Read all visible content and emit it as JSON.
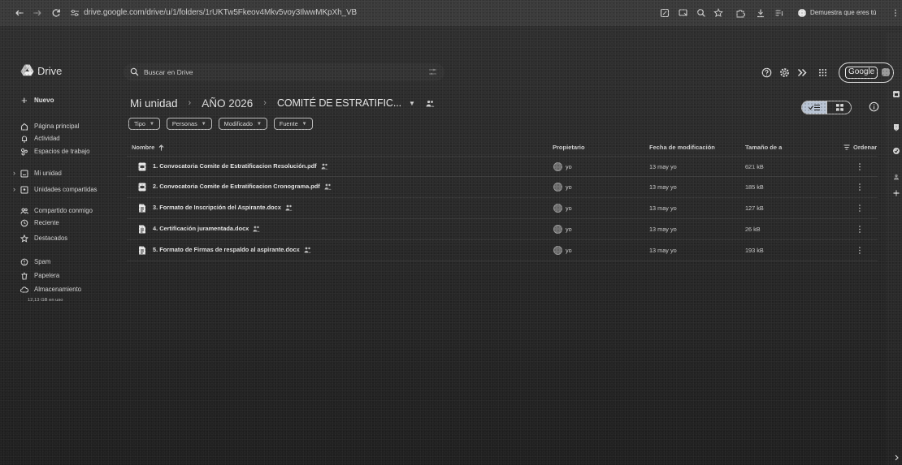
{
  "browser": {
    "url": "drive.google.com/drive/u/1/folders/1rUKTw5Fkeov4Mkv5voy3IlwwMKpXh_VB",
    "profile_label": "Demuestra que eres tú"
  },
  "header": {
    "app_name": "Drive",
    "search_placeholder": "Buscar en Drive",
    "account_label": "Google"
  },
  "sidebar": {
    "new_label": "Nuevo",
    "items": [
      {
        "label": "Página principal",
        "icon": "home-icon"
      },
      {
        "label": "Actividad",
        "icon": "bell-icon"
      },
      {
        "label": "Espacios de trabajo",
        "icon": "workspaces-icon"
      },
      {
        "label": "Mi unidad",
        "icon": "my-drive-icon"
      },
      {
        "label": "Unidades compartidas",
        "icon": "shared-drives-icon"
      },
      {
        "label": "Compartido conmigo",
        "icon": "shared-with-me-icon"
      },
      {
        "label": "Reciente",
        "icon": "clock-icon"
      },
      {
        "label": "Destacados",
        "icon": "star-icon"
      },
      {
        "label": "Spam",
        "icon": "spam-icon"
      },
      {
        "label": "Papelera",
        "icon": "trash-icon"
      },
      {
        "label": "Almacenamiento",
        "icon": "cloud-icon"
      }
    ],
    "storage_text": "12,13 GB en uso"
  },
  "breadcrumb": {
    "items": [
      "Mi unidad",
      "AÑO 2026",
      "COMITÉ DE ESTRATIFIC..."
    ]
  },
  "filters": {
    "chips": [
      "Tipo",
      "Personas",
      "Modificado",
      "Fuente"
    ]
  },
  "table": {
    "columns": {
      "name": "Nombre",
      "owner": "Propietario",
      "modified": "Fecha de modificación",
      "size": "Tamaño de a",
      "sort": "Ordenar"
    },
    "rows": [
      {
        "name": "1. Convocatoria Comite de Estratificacion Resolución.pdf",
        "icon": "pdf-file-icon",
        "shared": true,
        "owner": "yo",
        "modified": "13 may yo",
        "size": "621 kB"
      },
      {
        "name": "2. Convocatoria Comite de Estratificacion Cronograma.pdf",
        "icon": "pdf-file-icon",
        "shared": true,
        "owner": "yo",
        "modified": "13 may yo",
        "size": "185 kB"
      },
      {
        "name": "3. Formato de Inscripción del Aspirante.docx",
        "icon": "doc-file-icon",
        "shared": true,
        "owner": "yo",
        "modified": "13 may yo",
        "size": "127 kB"
      },
      {
        "name": "4. Certificación juramentada.docx",
        "icon": "doc-file-icon",
        "shared": true,
        "owner": "yo",
        "modified": "13 may yo",
        "size": "26 kB"
      },
      {
        "name": "5. Formato de Firmas de respaldo al aspirante.docx",
        "icon": "doc-file-icon",
        "shared": true,
        "owner": "yo",
        "modified": "13 may yo",
        "size": "193 kB"
      }
    ]
  },
  "colors": {
    "background": "#2a2a2a",
    "browser_bar": "#3b3b3b",
    "text": "#d4d4d4",
    "toggle_selected": "#b9c4d4"
  }
}
